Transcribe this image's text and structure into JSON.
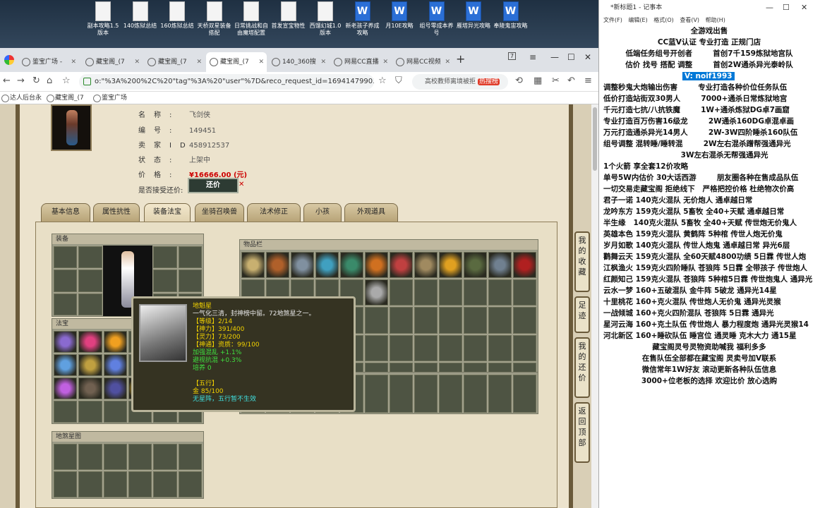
{
  "desktop_icons": [
    {
      "label": "副本攻略1.5版本",
      "type": "doc"
    },
    {
      "label": "140炼狱总结",
      "type": "doc"
    },
    {
      "label": "160炼狱总结",
      "type": "doc"
    },
    {
      "label": "天桥双星装备搭配",
      "type": "doc"
    },
    {
      "label": "日常挑战和自由魔塔配置",
      "type": "doc"
    },
    {
      "label": "首发宣宝物性",
      "type": "doc"
    },
    {
      "label": "西馏幻城1.0版本",
      "type": "doc"
    },
    {
      "label": "新老孩子养成攻略",
      "type": "word"
    },
    {
      "label": "月10E攻略",
      "type": "word"
    },
    {
      "label": "组号零成本养号",
      "type": "word"
    },
    {
      "label": "雁塔异光攻略",
      "type": "word"
    },
    {
      "label": "奉陵鬼宙攻略",
      "type": "word"
    }
  ],
  "browser": {
    "tabs": [
      {
        "label": "鉴宝广场 -",
        "active": false
      },
      {
        "label": "藏宝阁_(7",
        "active": false
      },
      {
        "label": "藏宝阁_(7",
        "active": false
      },
      {
        "label": "藏宝阁_(7",
        "active": true
      },
      {
        "label": "140_360搜",
        "active": false
      },
      {
        "label": "网易CC直播",
        "active": false
      },
      {
        "label": "网易CC视频",
        "active": false
      }
    ],
    "tab_count": "7",
    "url": "o:\"%3A%200%2C%20\"tag\"%3A%20\"user\"%7D&reco_request_id=1694147990392tfh.IM",
    "search_placeholder": "高校教师离境被拒",
    "search_hot": "热搜榜",
    "bookmarks": [
      "达人后台永",
      "藏宝阁_(7",
      "鉴宝广场"
    ]
  },
  "item_info": {
    "rows": [
      {
        "key": "名称:",
        "value": "飞剑侠"
      },
      {
        "key": "编号:",
        "value": "149451"
      },
      {
        "key": "卖家ID:",
        "value": "458912537"
      },
      {
        "key": "状态:",
        "value": "上架中"
      },
      {
        "key": "价格:",
        "value": "¥16666.00 (元)"
      }
    ],
    "counter_question": "是否接受还价:",
    "counter_button": "还价"
  },
  "game_tabs": [
    "基本信息",
    "属性抗性",
    "装备法宝",
    "坐骑召唤兽",
    "法术修正",
    "小孩",
    "外观道具"
  ],
  "active_tab": "装备法宝",
  "sections": {
    "equip": "装备",
    "treasure": "法宝",
    "items": "物品栏",
    "earth": "地煞星图"
  },
  "tooltip": {
    "name": "地魁星",
    "desc": "一气化三清，封神榜中留。72地煞星之一。",
    "level": "【等级】2/14",
    "power": "【神力】391/400",
    "spirit": "【灵力】73/200",
    "tong": "【神通】资质：99/100",
    "bonus1": "加强混乱 +1.1%",
    "bonus2": "避视抗混 +0.3%",
    "train": "培养 0",
    "wuxing": "【五行】",
    "gold": "金 85/100",
    "effect": "无星阵，五行暂不生效"
  },
  "side_buttons": [
    "我的收藏",
    "足迹",
    "我的还价",
    "返回顶部"
  ],
  "notepad": {
    "title": "*新标题1 - 记事本",
    "menu": [
      "文件(F)",
      "编辑(E)",
      "格式(O)",
      "查看(V)",
      "帮助(H)"
    ],
    "lines": [
      "全游戏出售",
      "CC蓝V认证 专业打造 正规门店",
      "低端任务组号开创者        首创7千159炼狱地宫队",
      "估价 找号 搭配 调整        首创2W通杀异光泰岭队",
      "V: noif1993",
      "",
      "调整秒鬼大炮输出伤害        专业打造各种价位任务队伍",
      "低价打造站街双30男人        7000+通杀日常炼狱地宫",
      "千元打造七抗/八抗铁魔        1W+通杀炼狱DG卓7画窟",
      "专业打造百万伤害16级龙        2W通杀160DG卓混卓画",
      "万元打造通杀异光14男人        2W-3W四阶睡杀160队伍",
      "组号调整 混转睡/睡转混        2W左右混杀蹭帮强通异光",
      "                              3W左右混杀无帮强通异光",
      "1个火箭 享全套12价攻略",
      "单号5W内估价 30大话西游        朋友圈各种在售成品队伍",
      "一切交易走藏宝阁 拒绝线下   严格把控价格 杜绝物次价高",
      "",
      "",
      "君子一诺 140克火混队 无价炮人 通卓越日常",
      "龙吟东方 159克火混队 5畜牧 全40+天赋 通卓越日常",
      "半生缘   140克火混队 5畜牧 全40+天赋 传世炮无价鬼人",
      "英雄本色 159克火混队 黄鹤阵 5种棺 传世人炮无价鬼",
      "岁月如歌 140克火混队 传世人炮鬼 通卓越日常 异光6层",
      "鹳舞云天 159克火混队 全60天赋4800功绩 5日霖 传世人炮",
      "江枫渔火 159克火四阶睡队 苍狼阵 5日霖 全带孩子 传世炮人",
      "红颜知己 159克火混队 苍狼阵 5种棺5日霖 传世炮鬼人 通异光",
      "云水一梦 160+五破混队 金牛阵 5破龙 通异光14星",
      "十里桃花 160+克火混队 传世炮人无价鬼 通异光灵猴",
      "一战倾城 160+克火四阶混队 苍狼阵 5日霖 通异光",
      "星河云海 160+克土队伍 传世炮人 暴力程度炮 通异光灵猴14",
      "河北新区 160+睡砍队伍 睡宫位 通灵睡 克木大力 通15星",
      "",
      "藏宝阁灵号灵物资助喊我 福利多多",
      "在售队伍全部都在藏宝阁 灵卖号加V联系",
      "微信常年1W好友 滚动更新各种队伍信息",
      "3000+位老板的选择 欢迎比价 放心选购"
    ]
  },
  "colors": {
    "accent": "#0078d7",
    "price": "#cc0000",
    "tooltip_bg": "#353322"
  }
}
